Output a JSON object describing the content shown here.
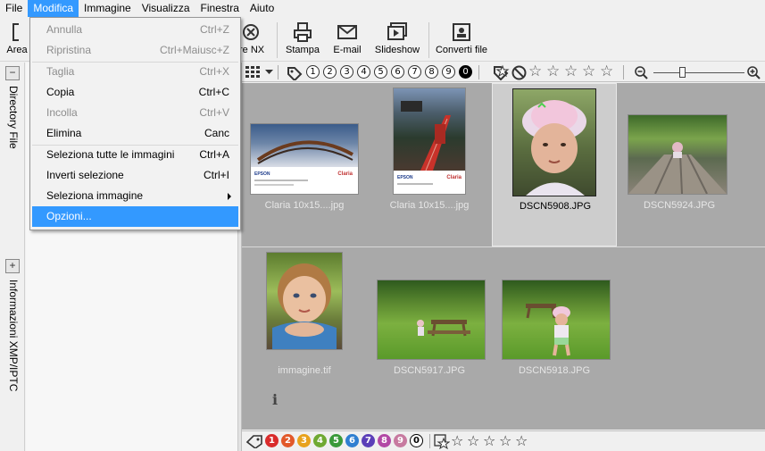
{
  "menubar": {
    "items": [
      "File",
      "Modifica",
      "Immagine",
      "Visualizza",
      "Finestra",
      "Aiuto"
    ],
    "active": "Modifica"
  },
  "toolbar": {
    "area_label": "Area",
    "capture_nx_label": "ure NX",
    "print_label": "Stampa",
    "email_label": "E-mail",
    "slideshow_label": "Slideshow",
    "convert_label": "Converti file"
  },
  "edit_menu": {
    "items": [
      {
        "label": "Annulla",
        "shortcut": "Ctrl+Z",
        "enabled": false
      },
      {
        "label": "Ripristina",
        "shortcut": "Ctrl+Maiusc+Z",
        "enabled": false
      },
      {
        "label": "Taglia",
        "shortcut": "Ctrl+X",
        "enabled": false
      },
      {
        "label": "Copia",
        "shortcut": "Ctrl+C",
        "enabled": true
      },
      {
        "label": "Incolla",
        "shortcut": "Ctrl+V",
        "enabled": false
      },
      {
        "label": "Elimina",
        "shortcut": "Canc",
        "enabled": true
      },
      {
        "label": "Seleziona tutte le immagini",
        "shortcut": "Ctrl+A",
        "enabled": true
      },
      {
        "label": "Inverti selezione",
        "shortcut": "Ctrl+I",
        "enabled": true
      },
      {
        "label": "Seleziona immagine",
        "shortcut": "",
        "enabled": true,
        "submenu": true
      },
      {
        "label": "Opzioni...",
        "shortcut": "",
        "enabled": true,
        "highlighted": true
      }
    ]
  },
  "left_tabs": {
    "directory_label": "Directory File",
    "xmp_label": "Informazioni XMP/IPTC",
    "collapse_symbol": "−",
    "expand_symbol": "+"
  },
  "browser_toolbar": {
    "labels": [
      "1",
      "2",
      "3",
      "4",
      "5",
      "6",
      "7",
      "8",
      "9",
      "0"
    ],
    "ratings": [
      "1",
      "2",
      "3",
      "4",
      "5"
    ]
  },
  "thumbnails": [
    {
      "caption": "Claria 10x15....jpg",
      "selected": false
    },
    {
      "caption": "Claria 10x15....jpg",
      "selected": false
    },
    {
      "caption": "DSCN5908.JPG",
      "selected": true
    },
    {
      "caption": "DSCN5924.JPG",
      "selected": false
    },
    {
      "caption": "immagine.tif",
      "selected": false
    },
    {
      "caption": "DSCN5917.JPG",
      "selected": false
    },
    {
      "caption": "DSCN5918.JPG",
      "selected": false
    }
  ],
  "print_sample_text": {
    "brand": "EPSON",
    "paper": "Claria"
  },
  "info_glyph": "i",
  "bottom_bar": {
    "labels": [
      "1",
      "2",
      "3",
      "4",
      "5",
      "6",
      "7",
      "8",
      "9",
      "0"
    ],
    "label_colors": [
      "#d92b2b",
      "#e2592a",
      "#e8a21c",
      "#6fa932",
      "#3a9a3a",
      "#2f7fd1",
      "#5b3fb8",
      "#b248a5",
      "#c77aa0",
      "#000000"
    ]
  }
}
